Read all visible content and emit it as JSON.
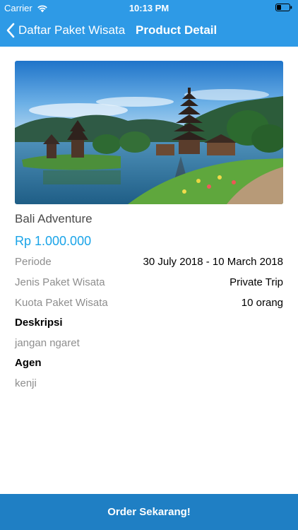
{
  "status_bar": {
    "carrier": "Carrier",
    "time": "10:13 PM"
  },
  "nav": {
    "back_label": "Daftar Paket Wisata",
    "title": "Product Detail"
  },
  "product": {
    "name": "Bali Adventure",
    "price": "Rp 1.000.000",
    "details": [
      {
        "label": "Periode",
        "value": "30 July 2018 - 10 March 2018"
      },
      {
        "label": "Jenis Paket Wisata",
        "value": "Private Trip"
      },
      {
        "label": "Kuota Paket Wisata",
        "value": "10 orang"
      }
    ],
    "description_heading": "Deskripsi",
    "description": "jangan ngaret",
    "agent_heading": "Agen",
    "agent": "kenji"
  },
  "order_button_label": "Order Sekarang!",
  "colors": {
    "header": "#2e9ae6",
    "price": "#1aa4e8",
    "order_button": "#1f7fc4"
  }
}
